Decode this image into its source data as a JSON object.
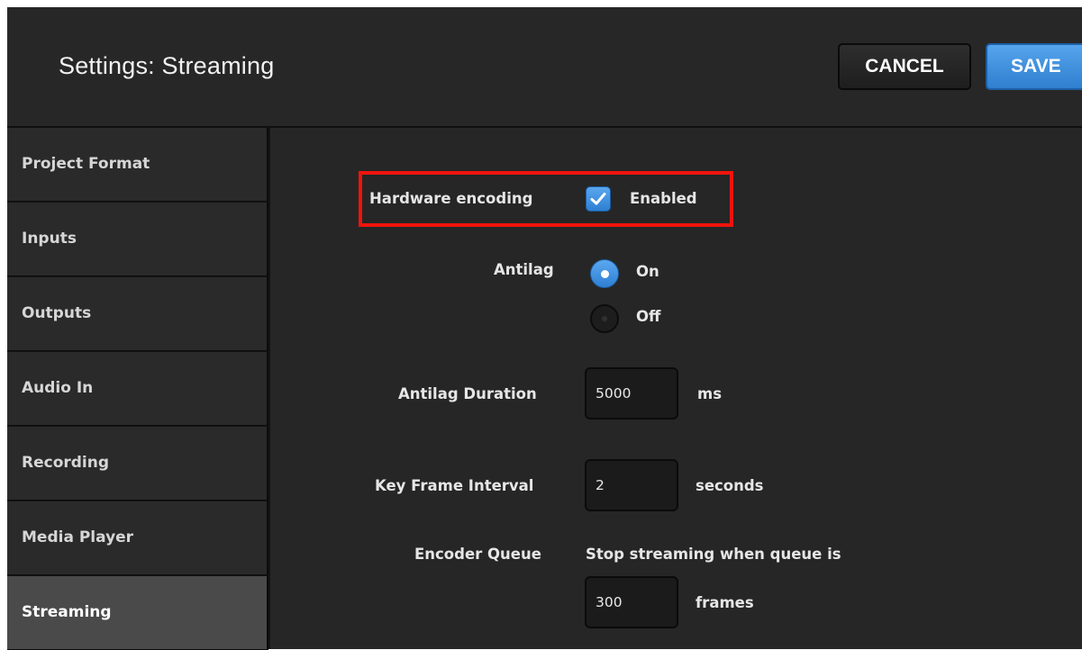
{
  "header": {
    "title": "Settings: Streaming",
    "cancel_label": "CANCEL",
    "save_label": "SAVE"
  },
  "sidebar": {
    "items": [
      {
        "label": "Project Format",
        "active": false
      },
      {
        "label": "Inputs",
        "active": false
      },
      {
        "label": "Outputs",
        "active": false
      },
      {
        "label": "Audio In",
        "active": false
      },
      {
        "label": "Recording",
        "active": false
      },
      {
        "label": "Media Player",
        "active": false
      },
      {
        "label": "Streaming",
        "active": true
      }
    ]
  },
  "form": {
    "hardware_encoding": {
      "label": "Hardware encoding",
      "checkbox_label": "Enabled",
      "checked": true
    },
    "antilag": {
      "label": "Antilag",
      "options": [
        {
          "label": "On",
          "selected": true
        },
        {
          "label": "Off",
          "selected": false
        }
      ]
    },
    "antilag_duration": {
      "label": "Antilag Duration",
      "value": "5000",
      "unit": "ms"
    },
    "key_frame_interval": {
      "label": "Key Frame Interval",
      "value": "2",
      "unit": "seconds"
    },
    "encoder_queue": {
      "label": "Encoder Queue",
      "description": "Stop streaming when queue is",
      "value": "300",
      "unit": "frames"
    }
  },
  "colors": {
    "accent": "#3a8ee0",
    "highlight": "#f0140d",
    "background": "#262626"
  }
}
